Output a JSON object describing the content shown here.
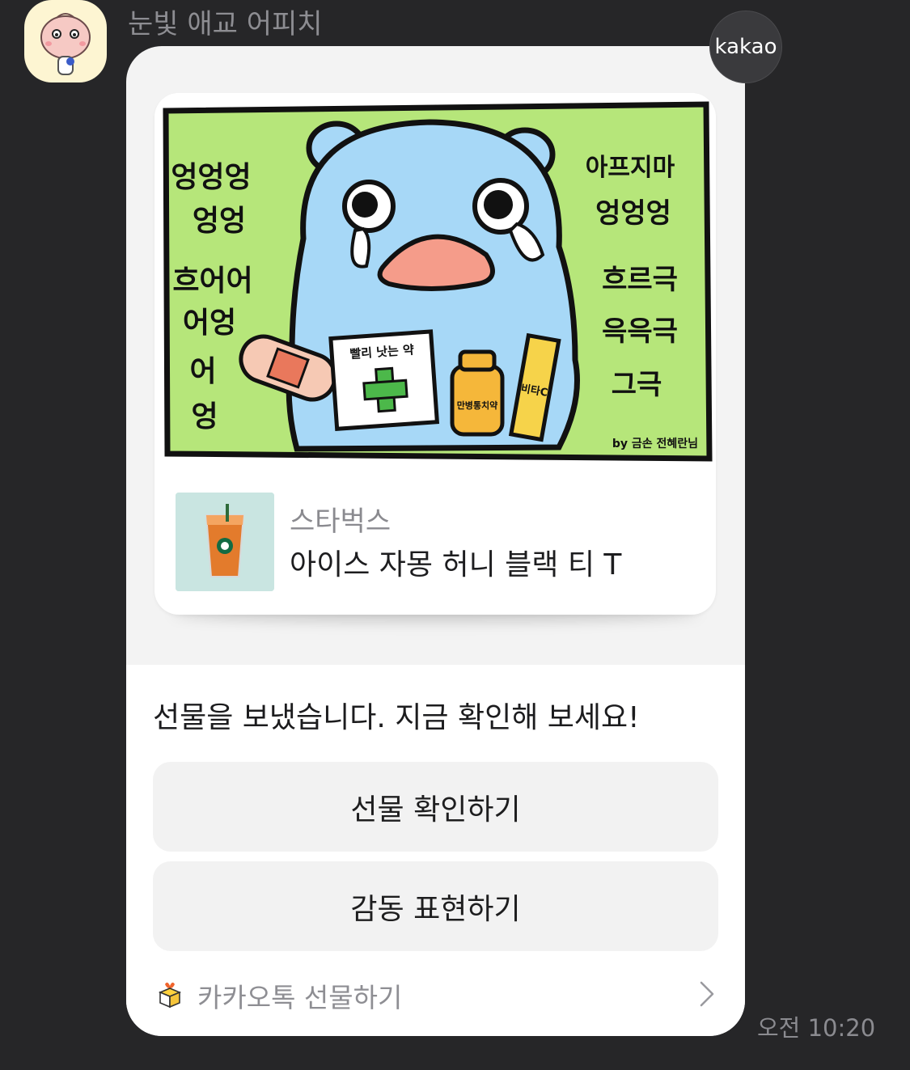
{
  "sender_name": "눈빛 애교 어피치",
  "badge_label": "kakao",
  "card": {
    "art_left_text": [
      "엉엉엉",
      "엉엉",
      "흐어어",
      "어엉",
      "어",
      "엉"
    ],
    "art_right_text": [
      "아프지마",
      "엉엉엉",
      "흐르극",
      "윽윽극",
      "그극"
    ],
    "art_items": {
      "medicine_box": "빨리 낫는 약",
      "jar": "만병통치약",
      "tube": "비타C"
    },
    "art_credit": "by 금손 전혜란님",
    "brand": "스타벅스",
    "product": "아이스 자몽 허니 블랙 티 T"
  },
  "message": "선물을 보냈습니다. 지금 확인해 보세요!",
  "buttons": {
    "check_gift": "선물 확인하기",
    "express_thanks": "감동 표현하기"
  },
  "footer": {
    "label": "카카오톡 선물하기"
  },
  "timestamp": "오전 10:20",
  "colors": {
    "background": "#262628",
    "art_green": "#b6e67a",
    "bear_blue": "#a7d8f7"
  },
  "icons": {
    "avatar": "apeach-avatar-icon",
    "footer": "gift-box-icon",
    "footer_arrow": "chevron-right-icon"
  }
}
